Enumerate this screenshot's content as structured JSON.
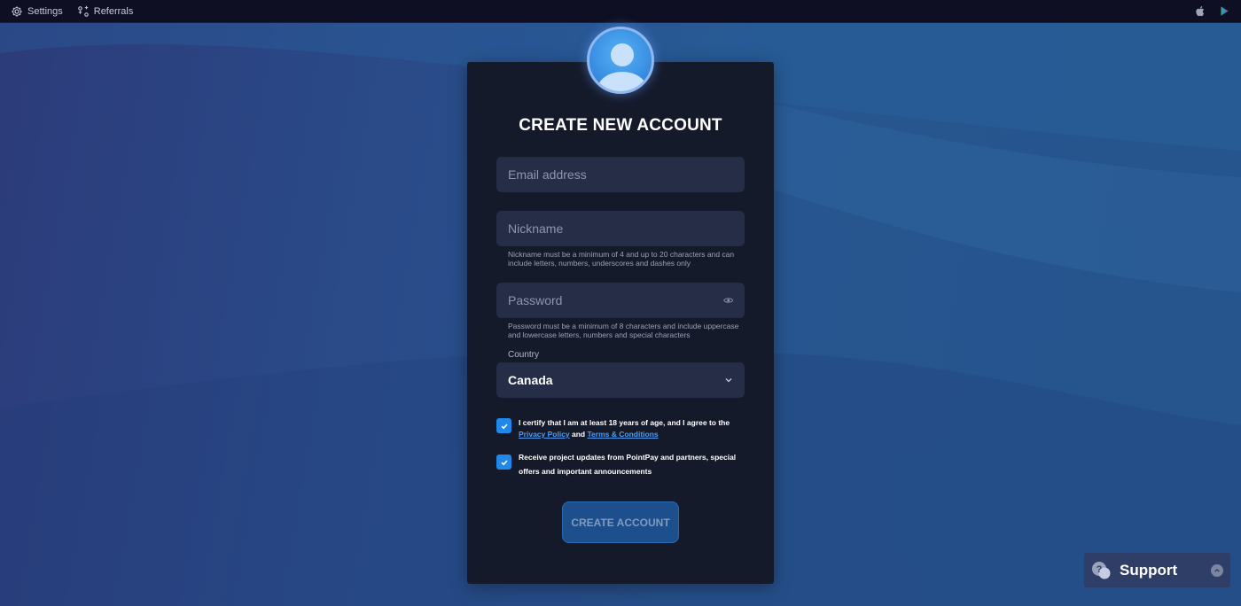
{
  "topbar": {
    "settings_label": "Settings",
    "referrals_label": "Referrals"
  },
  "form": {
    "title": "CREATE NEW ACCOUNT",
    "email": {
      "placeholder": "Email address",
      "value": ""
    },
    "nickname": {
      "placeholder": "Nickname",
      "value": "",
      "hint": "Nickname must be a minimum of 4 and up to 20 characters and can include letters, numbers, underscores and dashes only"
    },
    "password": {
      "placeholder": "Password",
      "value": "",
      "hint": "Password must be a minimum of 8 characters and include uppercase and lowercase letters, numbers and special characters"
    },
    "country": {
      "label": "Country",
      "selected": "Canada"
    },
    "consent_age": {
      "checked": true,
      "text_before": "I certify that I am at least 18 years of age, and I agree to the ",
      "privacy_link": "Privacy Policy",
      "and_text": " and ",
      "terms_link": "Terms & Conditions"
    },
    "consent_updates": {
      "checked": true,
      "text": "Receive project updates from PointPay and partners, special offers and important announcements"
    },
    "submit_label": "CREATE ACCOUNT"
  },
  "support": {
    "label": "Support"
  },
  "colors": {
    "accent": "#1f88e8",
    "card_bg": "#151a2b",
    "field_bg": "#262e47",
    "link": "#4d9ef2"
  },
  "icons": {
    "settings": "gear-icon",
    "referrals": "referrals-icon",
    "apple": "apple-icon",
    "play": "google-play-icon",
    "eye": "eye-icon",
    "chevron": "chevron-down-icon",
    "support": "chat-bubbles-icon",
    "collapse": "chevron-up-icon"
  }
}
